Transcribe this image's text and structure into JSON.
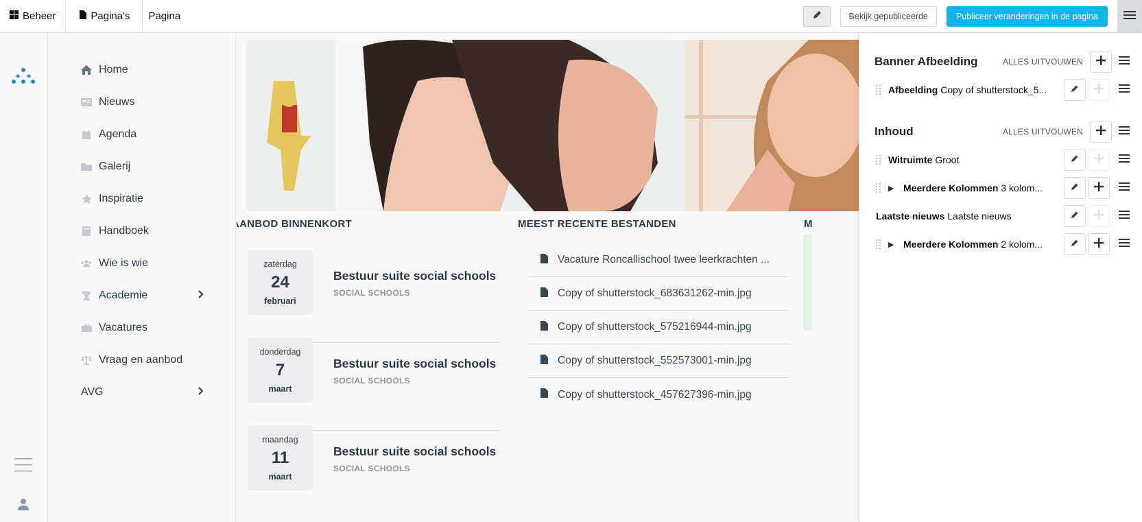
{
  "topbar": {
    "crumbs": [
      "Beheer",
      "Pagina's",
      "Pagina"
    ],
    "view_label": "Bekijk gepubliceerde",
    "publish_label": "Publiceer veranderingen in de pagina"
  },
  "nav": {
    "items": [
      "Home",
      "Nieuws",
      "Agenda",
      "Galerij",
      "Inspiratie",
      "Handboek",
      "Wie is wie",
      "Academie",
      "Vacatures",
      "Vraag en aanbod",
      "AVG"
    ]
  },
  "main": {
    "events_title": "AANBOD BINNENKORT",
    "files_title": "MEEST RECENTE BESTANDEN",
    "third_title_fragment": "M",
    "events": [
      {
        "day": "zaterdag",
        "num": "24",
        "month": "februari",
        "title": "Bestuur suite social schools",
        "sub": "SOCIAL SCHOOLS"
      },
      {
        "day": "donderdag",
        "num": "7",
        "month": "maart",
        "title": "Bestuur suite social schools",
        "sub": "SOCIAL SCHOOLS"
      },
      {
        "day": "maandag",
        "num": "11",
        "month": "maart",
        "title": "Bestuur suite social schools",
        "sub": "SOCIAL SCHOOLS"
      }
    ],
    "files": [
      "Vacature Roncallischool twee leerkrachten ...",
      "Copy of shutterstock_683631262-min.jpg",
      "Copy of shutterstock_575216944-min.jpg",
      "Copy of shutterstock_552573001-min.jpg",
      "Copy of shutterstock_457627396-min.jpg"
    ]
  },
  "panel": {
    "expand_label": "ALLES UITVOUWEN",
    "banner_title": "Banner Afbeelding",
    "banner_row": {
      "type": "Afbeelding",
      "desc": "Copy of shutterstock_5..."
    },
    "content_title": "Inhoud",
    "rows": [
      {
        "type": "Witruimte",
        "desc": "Groot"
      },
      {
        "type": "Meerdere Kolommen",
        "desc": "3 kolom..."
      },
      {
        "type": "Laatste nieuws",
        "desc": "Laatste nieuws"
      },
      {
        "type": "Meerdere Kolommen",
        "desc": "2 kolom..."
      }
    ]
  }
}
